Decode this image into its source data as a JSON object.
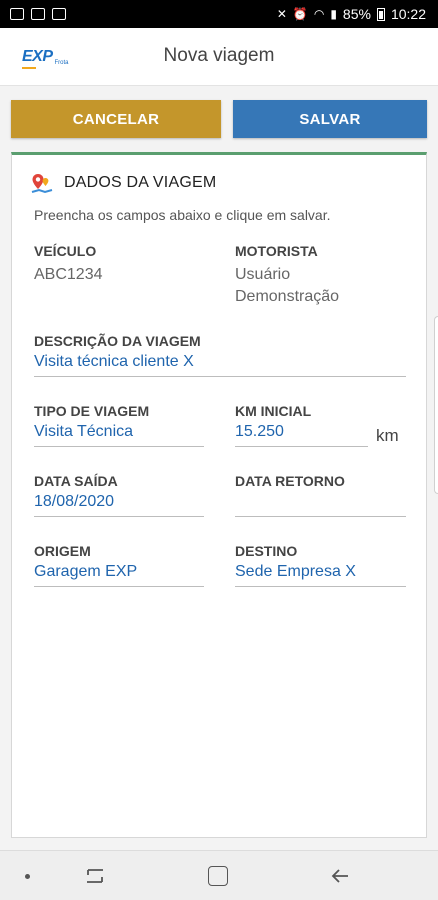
{
  "status_bar": {
    "battery": "85%",
    "time": "10:22"
  },
  "app_bar": {
    "logo": {
      "brand": "EXP",
      "sub": "Frota"
    },
    "title": "Nova viagem"
  },
  "actions": {
    "cancel_label": "CANCELAR",
    "save_label": "SALVAR",
    "cancel_color": "#c4962b",
    "save_color": "#3677b7"
  },
  "card": {
    "title": "DADOS DA VIAGEM",
    "subtitle": "Preencha os campos abaixo e clique em salvar.",
    "accent_color": "#5a9e6f",
    "fields": {
      "veiculo": {
        "label": "VEÍCULO",
        "value": "ABC1234"
      },
      "motorista": {
        "label": "MOTORISTA",
        "value_line1": "Usuário",
        "value_line2": "Demonstração"
      },
      "descricao": {
        "label": "DESCRIÇÃO DA VIAGEM",
        "value": "Visita técnica cliente X"
      },
      "tipo": {
        "label": "TIPO DE VIAGEM",
        "value": "Visita Técnica"
      },
      "km_inicial": {
        "label": "KM INICIAL",
        "value": "15.250",
        "unit": "km"
      },
      "data_saida": {
        "label": "DATA SAÍDA",
        "value": "18/08/2020"
      },
      "data_retorno": {
        "label": "DATA RETORNO",
        "value": ""
      },
      "origem": {
        "label": "ORIGEM",
        "value": "Garagem EXP"
      },
      "destino": {
        "label": "DESTINO",
        "value": "Sede Empresa X"
      }
    }
  },
  "icons": {
    "card_header": "map-pin-icon",
    "status_left": [
      "image-icon",
      "gallery-icon",
      "notification-icon"
    ],
    "status_right": [
      "mute-icon",
      "alarm-icon",
      "wifi-icon",
      "signal-icon",
      "battery-icon"
    ],
    "nav": [
      "dot-icon",
      "recent-apps-icon",
      "home-icon",
      "back-icon"
    ]
  }
}
